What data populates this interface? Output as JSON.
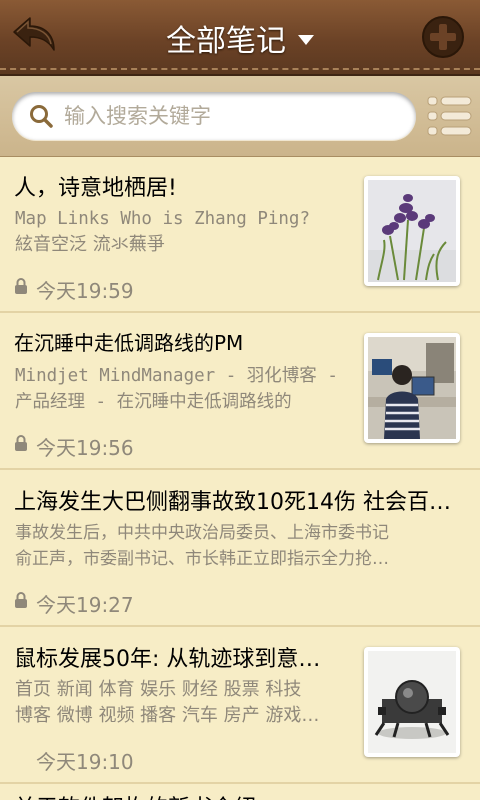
{
  "header": {
    "title": "全部笔记",
    "back_icon": "back-arrow-icon",
    "add_icon": "plus-icon"
  },
  "search": {
    "placeholder": "输入搜索关键字",
    "icon": "search-icon",
    "menu_icon": "list-menu-icon"
  },
  "colors": {
    "header_brown": "#6b4226",
    "paper": "#f7edc6",
    "meta_text": "#8f887a"
  },
  "notes": [
    {
      "title": "人，诗意地栖居!",
      "body_line1": "Map Links Who is Zhang Ping?",
      "body_line2": "絃音空泛 流氺蕪爭",
      "time": "今天19:59",
      "locked": true,
      "thumbnail": "purple-flowers-photo"
    },
    {
      "title": "在沉睡中走低调路线的PM",
      "body_line1": "Mindjet MindManager - 羽化博客 -",
      "body_line2": "产品经理 - 在沉睡中走低调路线的",
      "time": "今天19:56",
      "locked": true,
      "thumbnail": "person-at-computer-photo"
    },
    {
      "title": "上海发生大巴侧翻事故致10死14伤 社会百…",
      "body_line1": "事故发生后，中共中央政治局委员、上海市委书记",
      "body_line2": "俞正声，市委副书记、市长韩正立即指示全力抢…",
      "time": "今天19:27",
      "locked": true,
      "thumbnail": ""
    },
    {
      "title": "鼠标发展50年: 从轨迹球到意…",
      "body_line1": "首页 新闻 体育 娱乐 财经 股票 科技",
      "body_line2": "博客 微博 视频 播客 汽车 房产 游戏…",
      "time": "今天19:10",
      "locked": false,
      "thumbnail": "trackball-device-photo"
    }
  ],
  "partial_note_title": "关于软件架构的新书介绍"
}
